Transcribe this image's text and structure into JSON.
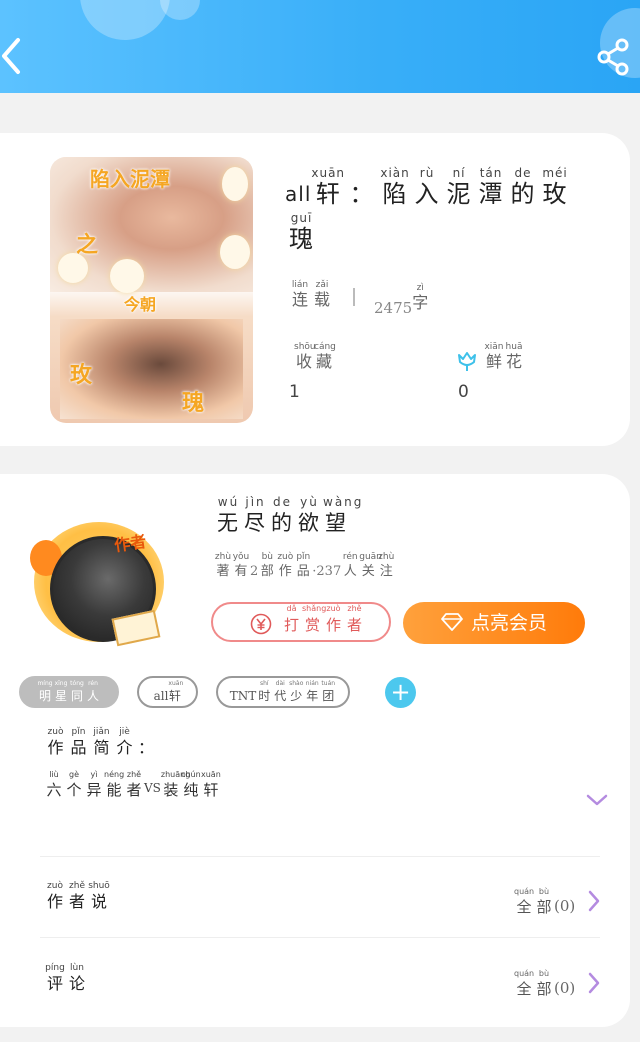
{
  "header": {
    "back_icon": "chevron-left-icon",
    "share_icon": "share-icon",
    "colors": {
      "start": "#5cc2ff",
      "end": "#2aa5f5"
    }
  },
  "book": {
    "cover_texts": [
      "陷入泥潭",
      "之",
      "今朝",
      "玫",
      "瑰"
    ],
    "title_prefix": "all",
    "title": [
      {
        "py": "xuān",
        "hz": "轩"
      },
      {
        "py": "",
        "hz": "："
      },
      {
        "py": "xiàn",
        "hz": "陷"
      },
      {
        "py": "rù",
        "hz": "入"
      },
      {
        "py": "ní",
        "hz": "泥"
      },
      {
        "py": "tán",
        "hz": "潭"
      },
      {
        "py": "de",
        "hz": "的"
      },
      {
        "py": "méi",
        "hz": "玫"
      }
    ],
    "title_line2": [
      {
        "py": "guī",
        "hz": "瑰"
      }
    ],
    "status": [
      {
        "py": "lián",
        "hz": "连"
      },
      {
        "py": "zǎi",
        "hz": "载"
      }
    ],
    "word_count": "2475",
    "word_unit": {
      "py": "zì",
      "hz": "字"
    },
    "favorites_label": [
      {
        "py": "shōu",
        "hz": "收"
      },
      {
        "py": "cáng",
        "hz": "藏"
      }
    ],
    "flowers_label": [
      {
        "py": "xiān",
        "hz": "鲜"
      },
      {
        "py": "huā",
        "hz": "花"
      }
    ],
    "favorites_count": "1",
    "flowers_count": "0",
    "flower_icon": "tulip-icon"
  },
  "author": {
    "avatar_tag": "作者",
    "name": [
      {
        "py": "wú",
        "hz": "无"
      },
      {
        "py": "jìn",
        "hz": "尽"
      },
      {
        "py": "de",
        "hz": "的"
      },
      {
        "py": "yù",
        "hz": "欲"
      },
      {
        "py": "wàng",
        "hz": "望"
      }
    ],
    "stats_a": [
      {
        "py": "zhù",
        "hz": "著"
      },
      {
        "py": "yǒu",
        "hz": "有"
      }
    ],
    "works_count": "2",
    "stats_b": [
      {
        "py": "bù",
        "hz": "部"
      },
      {
        "py": "zuò",
        "hz": "作"
      },
      {
        "py": "pǐn",
        "hz": "品"
      }
    ],
    "followers_count": "·237",
    "stats_c": [
      {
        "py": "rén",
        "hz": "人"
      },
      {
        "py": "guān",
        "hz": "关"
      },
      {
        "py": "zhù",
        "hz": "注"
      }
    ],
    "reward_button": [
      {
        "py": "dǎ",
        "hz": "打"
      },
      {
        "py": "shǎng",
        "hz": "赏"
      },
      {
        "py": "zuò",
        "hz": "作"
      },
      {
        "py": "zhě",
        "hz": "者"
      }
    ],
    "vip_button": "点亮会员",
    "accent": "#ff8a1f"
  },
  "tags": {
    "tag1": [
      {
        "py": "míng",
        "hz": "明"
      },
      {
        "py": "xīng",
        "hz": "星"
      },
      {
        "py": "tóng",
        "hz": "同"
      },
      {
        "py": "rén",
        "hz": "人"
      }
    ],
    "tag2_prefix": "all",
    "tag2": [
      {
        "py": "xuān",
        "hz": "轩"
      }
    ],
    "tag3_prefix": "TNT",
    "tag3": [
      {
        "py": "shí",
        "hz": "时"
      },
      {
        "py": "dài",
        "hz": "代"
      },
      {
        "py": "shào",
        "hz": "少"
      },
      {
        "py": "nián",
        "hz": "年"
      },
      {
        "py": "tuán",
        "hz": "团"
      }
    ],
    "add_label": "+"
  },
  "intro": {
    "title": [
      {
        "py": "zuò",
        "hz": "作"
      },
      {
        "py": "pǐn",
        "hz": "品"
      },
      {
        "py": "jiǎn",
        "hz": "简"
      },
      {
        "py": "jiè",
        "hz": "介"
      },
      {
        "py": "",
        "hz": "："
      }
    ],
    "text_a": [
      {
        "py": "liù",
        "hz": "六"
      },
      {
        "py": "gè",
        "hz": "个"
      },
      {
        "py": "yì",
        "hz": "异"
      },
      {
        "py": "néng",
        "hz": "能"
      },
      {
        "py": "zhě",
        "hz": "者"
      }
    ],
    "text_vs": "VS",
    "text_b": [
      {
        "py": "zhuāng",
        "hz": "装"
      },
      {
        "py": "chún",
        "hz": "纯"
      },
      {
        "py": "xuān",
        "hz": "轩"
      }
    ]
  },
  "rows": {
    "author_says": [
      {
        "py": "zuò",
        "hz": "作"
      },
      {
        "py": "zhě",
        "hz": "者"
      },
      {
        "py": "shuō",
        "hz": "说"
      }
    ],
    "comments": [
      {
        "py": "píng",
        "hz": "评"
      },
      {
        "py": "lùn",
        "hz": "论"
      }
    ],
    "all": [
      {
        "py": "quán",
        "hz": "全"
      },
      {
        "py": "bù",
        "hz": "部"
      }
    ],
    "author_says_count": "(0)",
    "comments_count": "(0)"
  }
}
